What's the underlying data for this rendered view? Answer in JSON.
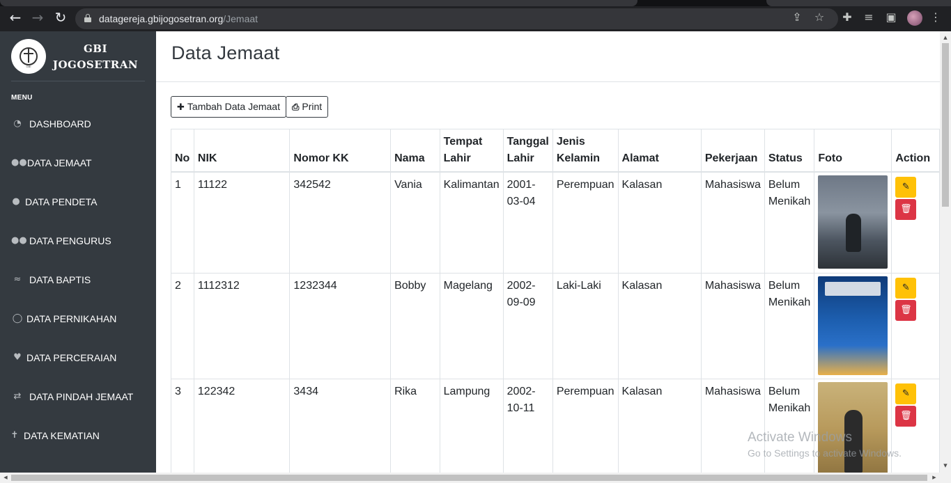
{
  "browser": {
    "url_host": "datagereja.gbijogosetran.org",
    "url_path": "/Jemaat"
  },
  "sidebar": {
    "brand_line1": "GBI",
    "brand_line2": "JOGOSETRAN",
    "logo_text": "GBI",
    "menu_heading": "MENU",
    "items": [
      {
        "label": "DASHBOARD",
        "icon": "tachometer-icon"
      },
      {
        "label": "DATA JEMAAT",
        "icon": "users-icon"
      },
      {
        "label": "DATA PENDETA",
        "icon": "user-icon"
      },
      {
        "label": "DATA PENGURUS",
        "icon": "user-friends-icon"
      },
      {
        "label": "DATA BAPTIS",
        "icon": "swimmer-icon"
      },
      {
        "label": "DATA PERNIKAHAN",
        "icon": "ring-icon"
      },
      {
        "label": "DATA PERCERAIAN",
        "icon": "heart-broken-icon"
      },
      {
        "label": "DATA PINDAH JEMAAT",
        "icon": "people-arrows-icon"
      },
      {
        "label": "DATA KEMATIAN",
        "icon": "cross-icon"
      }
    ]
  },
  "main": {
    "title": "Data Jemaat",
    "add_button": "Tambah Data Jemaat",
    "print_button": "Print",
    "table": {
      "headers": {
        "no": "No",
        "nik": "NIK",
        "nomor_kk": "Nomor KK",
        "nama": "Nama",
        "tempat_lahir_1": "Tempat",
        "tempat_lahir_2": "Lahir",
        "tanggal_lahir_1": "Tanggal",
        "tanggal_lahir_2": "Lahir",
        "jenis_kelamin_1": "Jenis",
        "jenis_kelamin_2": "Kelamin",
        "alamat": "Alamat",
        "pekerjaan": "Pekerjaan",
        "status": "Status",
        "foto": "Foto",
        "action": "Action"
      },
      "rows": [
        {
          "no": "1",
          "nik": "11122",
          "nomor_kk": "342542",
          "nama": "Vania",
          "tempat_lahir": "Kalimantan",
          "tanggal_lahir_1": "2001-",
          "tanggal_lahir_2": "03-04",
          "jenis_kelamin": "Perempuan",
          "alamat": "Kalasan",
          "pekerjaan": "Mahasiswa",
          "status_1": "Belum",
          "status_2": "Menikah"
        },
        {
          "no": "2",
          "nik": "1112312",
          "nomor_kk": "1232344",
          "nama": "Bobby",
          "tempat_lahir": "Magelang",
          "tanggal_lahir_1": "2002-",
          "tanggal_lahir_2": "09-09",
          "jenis_kelamin": "Laki-Laki",
          "alamat": "Kalasan",
          "pekerjaan": "Mahasiswa",
          "status_1": "Belum",
          "status_2": "Menikah"
        },
        {
          "no": "3",
          "nik": "122342",
          "nomor_kk": "3434",
          "nama": "Rika",
          "tempat_lahir": "Lampung",
          "tanggal_lahir_1": "2002-",
          "tanggal_lahir_2": "10-11",
          "jenis_kelamin": "Perempuan",
          "alamat": "Kalasan",
          "pekerjaan": "Mahasiswa",
          "status_1": "Belum",
          "status_2": "Menikah"
        }
      ]
    }
  },
  "watermark": {
    "line1": "Activate Windows",
    "line2": "Go to Settings to activate Windows."
  },
  "colors": {
    "sidebar_bg": "#343a40",
    "edit_button": "#ffc107",
    "delete_button": "#dc3545"
  }
}
